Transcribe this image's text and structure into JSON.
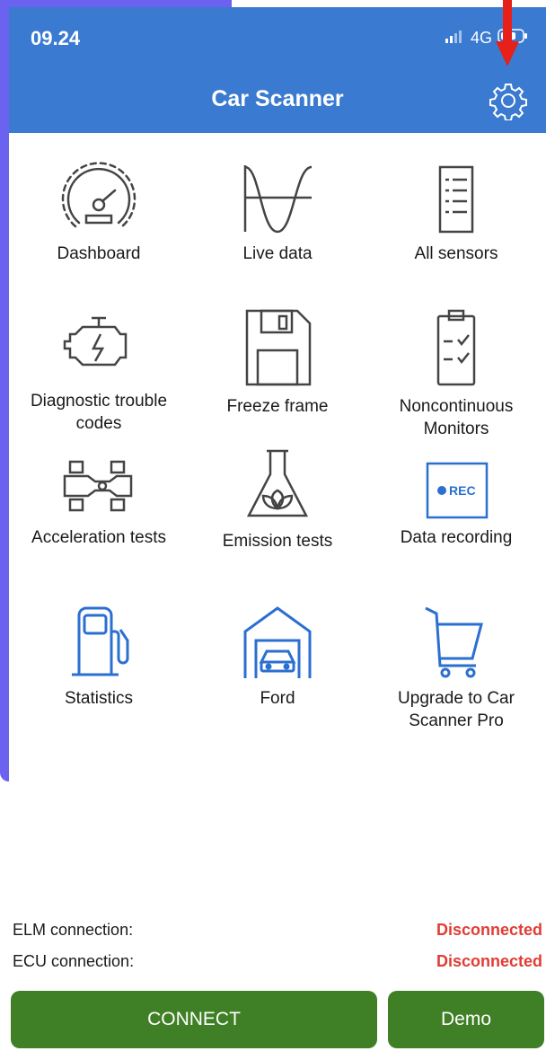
{
  "status_bar": {
    "time": "09.24",
    "network": "4G"
  },
  "header": {
    "title": "Car Scanner"
  },
  "menu": [
    {
      "id": "dashboard",
      "label": "Dashboard"
    },
    {
      "id": "live-data",
      "label": "Live data"
    },
    {
      "id": "all-sensors",
      "label": "All sensors"
    },
    {
      "id": "dtc",
      "label": "Diagnostic trouble codes"
    },
    {
      "id": "freeze-frame",
      "label": "Freeze frame"
    },
    {
      "id": "noncontinuous",
      "label": "Noncontinuous Monitors"
    },
    {
      "id": "acceleration",
      "label": "Acceleration tests"
    },
    {
      "id": "emission",
      "label": "Emission tests"
    },
    {
      "id": "recording",
      "label": "Data recording",
      "badge": "REC"
    },
    {
      "id": "statistics",
      "label": "Statistics"
    },
    {
      "id": "ford",
      "label": "Ford"
    },
    {
      "id": "upgrade",
      "label": "Upgrade to Car Scanner Pro"
    }
  ],
  "connection": {
    "elm_label": "ELM connection:",
    "elm_value": "Disconnected",
    "ecu_label": "ECU connection:",
    "ecu_value": "Disconnected"
  },
  "buttons": {
    "connect": "CONNECT",
    "demo": "Demo"
  },
  "colors": {
    "header": "#3a7ad0",
    "icon_blue": "#2b6fd0",
    "button_green": "#3f7f25",
    "status_red": "#e13c35"
  }
}
